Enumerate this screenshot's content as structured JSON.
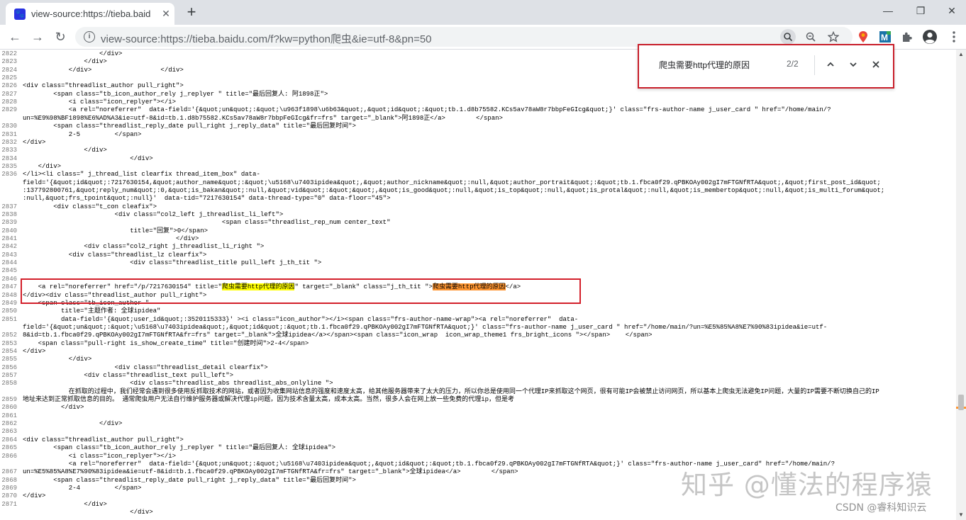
{
  "browser": {
    "tab_title": "view-source:https://tieba.baid",
    "tab_favicon": "🐾",
    "tab_close": "✕",
    "new_tab": "+",
    "window_minimize": "—",
    "window_restore": "❐",
    "window_close": "✕",
    "back": "←",
    "forward": "→",
    "reload": "↻",
    "info_glyph": "i",
    "url": "view-source:https://tieba.baidu.com/f?kw=python爬虫&ie=utf-8&pn=50",
    "icons": [
      "search-icon",
      "zoom-out-icon",
      "bookmark-star-icon",
      "location-extension-icon",
      "m-extension-icon",
      "puzzle-extensions-icon",
      "profile-avatar-icon",
      "menu-kebab-icon"
    ]
  },
  "find_bar": {
    "query": "爬虫需要http代理的原因",
    "count": "2/2",
    "prev": "⌃",
    "next": "⌄",
    "close": "✕"
  },
  "source": {
    "line_numbers": [
      "2822",
      "2823",
      "2824",
      "2825",
      "2826",
      "2827",
      "2828",
      "2829",
      "",
      "2830",
      "2831",
      "2832",
      "2833",
      "2834",
      "2835",
      "2836",
      "",
      "",
      "",
      "2837",
      "2838",
      "2839",
      "2840",
      "2841",
      "2842",
      "2843",
      "2844",
      "2845",
      "2846",
      "2847",
      "2848",
      "2849",
      "2850",
      "2851",
      "",
      "2852",
      "2853",
      "2854",
      "2855",
      "2856",
      "2857",
      "2858",
      "",
      "2859",
      "2860",
      "2861",
      "2862",
      "2863",
      "2864",
      "2865",
      "2866",
      "",
      "2867",
      "2868",
      "2869",
      "2870",
      "2871"
    ],
    "lines": [
      "                    </div>",
      "                </div>",
      "            </div>                  </div>",
      "",
      "<div class=\"threadlist_author pull_right\">",
      "        <span class=\"tb_icon_author_rely j_replyer \" title=\"最后回复人: 阿1898正\">",
      "            <i class=\"icon_replyer\"></i>",
      "            <a rel=\"noreferrer\"  data-field='{&quot;un&quot;:&quot;\\u963f1898\\u6b63&quot;,&quot;id&quot;:&quot;tb.1.d8b75582.KCs5av78aW8r7bbpFeGIcg&quot;}' class=\"frs-author-name j_user_card \" href=\"/home/main/?",
      "un=%E9%98%BF1898%E6%AD%A3&ie=utf-8&id=tb.1.d8b75582.KCs5av78aW8r7bbpFeGIcg&fr=frs\" target=\"_blank\">阿1898正</a>        </span>",
      "        <span class=\"threadlist_reply_date pull_right j_reply_data\" title=\"最后回复时间\">",
      "            2-5         </span>",
      "</div>",
      "                </div>",
      "                            </div>",
      "    </div>",
      "</li><li class=\" j_thread_list clearfix thread_item_box\" data-",
      "field='{&quot;id&quot;:7217630154,&quot;author_name&quot;:&quot;\\u5168\\u7403ipidea&quot;,&quot;author_nickname&quot;:null,&quot;author_portrait&quot;:&quot;tb.1.fbca0f29.qPBKOAy002gI7mFTGNfRTA&quot;,&quot;first_post_id&quot;",
      ":137792800761,&quot;reply_num&quot;:0,&quot;is_bakan&quot;:null,&quot;vid&quot;:&quot;&quot;,&quot;is_good&quot;:null,&quot;is_top&quot;:null,&quot;is_protal&quot;:null,&quot;is_membertop&quot;:null,&quot;is_multi_forum&quot;",
      ":null,&quot;frs_tpoint&quot;:null}'  data-tid=\"7217630154\" data-thread-type=\"0\" data-floor=\"45\">",
      "        <div class=\"t_con cleafix\">",
      "                        <div class=\"col2_left j_threadlist_li_left\">",
      "                                                    <span class=\"threadlist_rep_num center_text\"",
      "                            title=\"回复\">0</span>",
      "                                        </div>",
      "                <div class=\"col2_right j_threadlist_li_right \">",
      "            <div class=\"threadlist_lz clearfix\">",
      "                            <div class=\"threadlist_title pull_left j_th_tit \">",
      "",
      "",
      "    <a rel=\"noreferrer\" href=\"/p/7217630154\" title=\"{{H1}}\" target=\"_blank\" class=\"j_th_tit \">{{H2}}</a>",
      "</div><div class=\"threadlist_author pull_right\">",
      "    <span class=\"tb_icon_author \"",
      "          title=\"主题作者: 全球ipidea\"",
      "          data-field='{&quot;user_id&quot;:3520115333}' ><i class=\"icon_author\"></i><span class=\"frs-author-name-wrap\"><a rel=\"noreferrer\"  data-",
      "field='{&quot;un&quot;:&quot;\\u5168\\u7403ipidea&quot;,&quot;id&quot;:&quot;tb.1.fbca0f29.qPBKOAy002gI7mFTGNfRTA&quot;}' class=\"frs-author-name j_user_card \" href=\"/home/main/?un=%E5%85%A8%E7%90%83ipidea&ie=utf-",
      "8&id=tb.1.fbca0f29.qPBKOAy002gI7mFTGNfRTA&fr=frs\" target=\"_blank\">全球ipidea</a></span><span class=\"icon_wrap  icon_wrap_theme1 frs_bright_icons \"></span>    </span>",
      "    <span class=\"pull-right is_show_create_time\" title=\"创建时间\">2-4</span>",
      "</div>",
      "            </div>",
      "                        <div class=\"threadlist_detail clearfix\">",
      "                <div class=\"threadlist_text pull_left\">",
      "                            <div class=\"threadlist_abs threadlist_abs_onlyline \">",
      "            在抓取的过程中，我们经常会遇到很多使用反抓取技术的网站，或者因为收集网站信息的强度和速度太高，给其他服务器带来了太大的压力，所以你总是使用同一个代理IP来抓取这个网页，很有可能IP会被禁止访问网页，所以基本上爬虫无法避免IP问题，大量的IP需要不断切换自己的IP",
      "地址来达到正常抓取信息的目的。 通常爬虫用户无法自行维护服务器或解决代理ip问题，因为技术含量太高，成本太高。当然，很多人会在网上放一些免费的代理ip，但是考",
      "          </div>",
      "",
      "                    </div>",
      "",
      "<div class=\"threadlist_author pull_right\">",
      "        <span class=\"tb_icon_author_rely j_replyer \" title=\"最后回复人: 全球ipidea\">",
      "            <i class=\"icon_replyer\"></i>",
      "            <a rel=\"noreferrer\"  data-field='{&quot;un&quot;:&quot;\\u5168\\u7403ipidea&quot;,&quot;id&quot;:&quot;tb.1.fbca0f29.qPBKOAy002gI7mFTGNfRTA&quot;}' class=\"frs-author-name j_user_card\" href=\"/home/main/?",
      "un=%E5%85%A8%E7%90%83ipidea&ie=utf-8&id=tb.1.fbca0f29.qPBKOAy002gI7mFTGNfRTA&fr=frs\" target=\"_blank\">全球ipidea</a>        </span>",
      "        <span class=\"threadlist_reply_date pull_right j_reply_data\" title=\"最后回复时间\">",
      "            2-4         </span>",
      "</div>",
      "                </div>",
      "                            </div>"
    ],
    "match_text": "爬虫需要http代理的原因",
    "highlight_line_index": 29
  },
  "watermark": {
    "zhihu": "知乎 @懂法的程序猿",
    "csdn": "CSDN @睿科知识云"
  },
  "scrollbar": {
    "up": "▲",
    "down": "▼",
    "position_fraction": 0.77
  }
}
